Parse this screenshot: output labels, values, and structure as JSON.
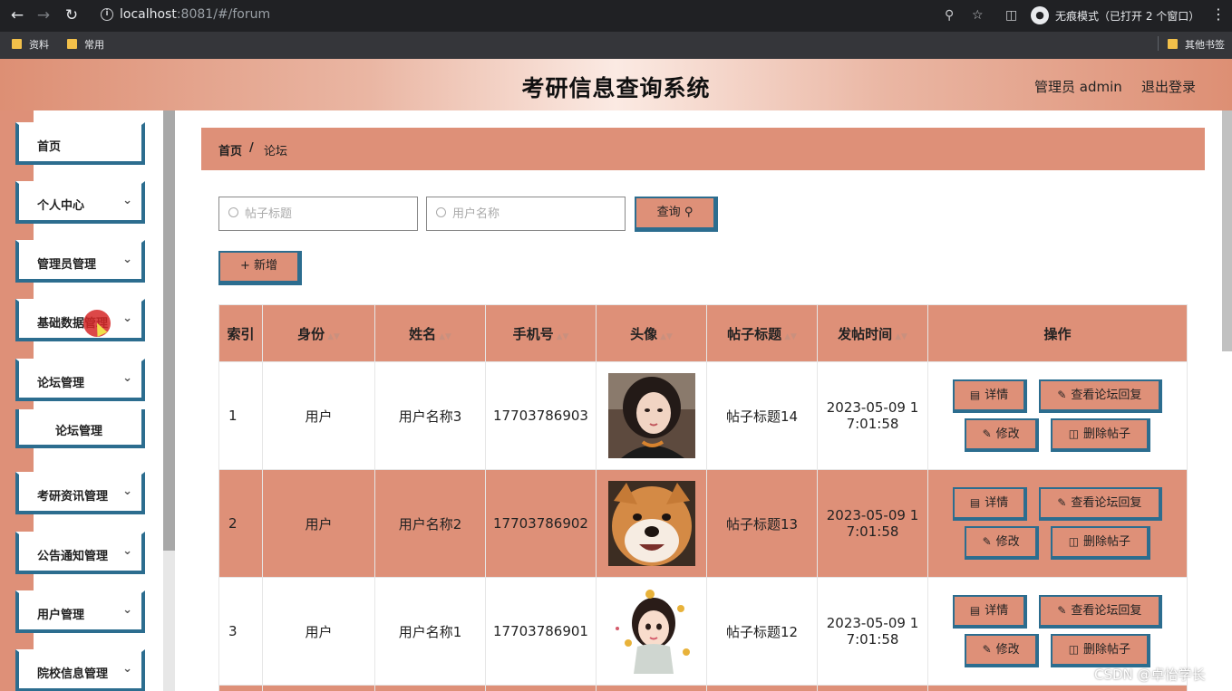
{
  "browser": {
    "url_host": "localhost",
    "url_rest": ":8081/#/forum",
    "incognito_label": "无痕模式（已打开 2 个窗口）",
    "bookmarks": [
      "资料",
      "常用"
    ],
    "other_bookmarks": "其他书签"
  },
  "header": {
    "title": "考研信息查询系统",
    "admin": "管理员 admin",
    "logout": "退出登录"
  },
  "sidebar": {
    "items": [
      {
        "label": "首页"
      },
      {
        "label": "个人中心"
      },
      {
        "label": "管理员管理"
      },
      {
        "label": "基础数据管理"
      },
      {
        "label": "论坛管理"
      },
      {
        "label": "考研资讯管理"
      },
      {
        "label": "公告通知管理"
      },
      {
        "label": "用户管理"
      },
      {
        "label": "院校信息管理"
      }
    ],
    "sub_item": "论坛管理"
  },
  "breadcrumb": {
    "home": "首页",
    "sep": "/",
    "current": "论坛"
  },
  "search": {
    "title_placeholder": "帖子标题",
    "user_placeholder": "用户名称",
    "query_label": "查询"
  },
  "toolbar": {
    "add_label": "新增"
  },
  "table": {
    "headers": [
      "索引",
      "身份",
      "姓名",
      "手机号",
      "头像",
      "帖子标题",
      "发帖时间",
      "操作"
    ],
    "rows": [
      {
        "index": "1",
        "role": "用户",
        "name": "用户名称3",
        "phone": "17703786903",
        "title": "帖子标题14",
        "time1": "2023-05-09 1",
        "time2": "7:01:58"
      },
      {
        "index": "2",
        "role": "用户",
        "name": "用户名称2",
        "phone": "17703786902",
        "title": "帖子标题13",
        "time1": "2023-05-09 1",
        "time2": "7:01:58"
      },
      {
        "index": "3",
        "role": "用户",
        "name": "用户名称1",
        "phone": "17703786901",
        "title": "帖子标题12",
        "time1": "2023-05-09 1",
        "time2": "7:01:58"
      }
    ],
    "actions": {
      "detail": "详情",
      "reply": "查看论坛回复",
      "edit": "修改",
      "delete": "删除帖子"
    }
  },
  "watermark": "CSDN @卓怡学长",
  "colors": {
    "accent": "#de9078",
    "border": "#2c6d8f"
  }
}
